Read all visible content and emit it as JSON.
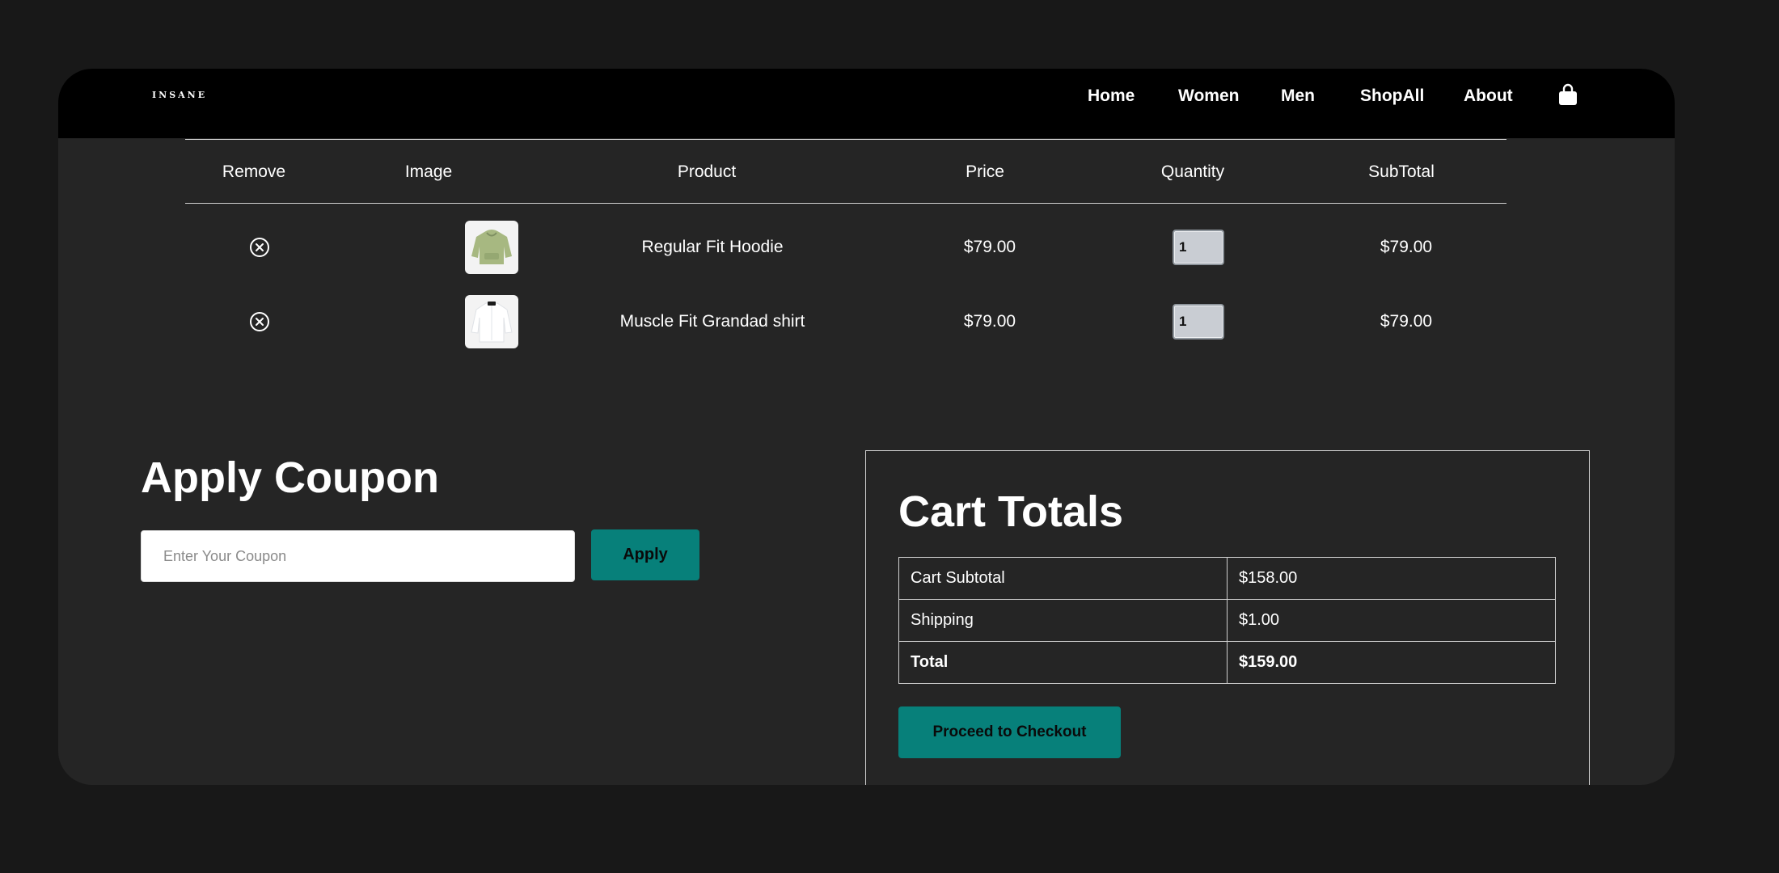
{
  "brand": {
    "logo_text": "INSANE"
  },
  "nav": {
    "items": [
      {
        "label": "Home"
      },
      {
        "label": "Women"
      },
      {
        "label": "Men"
      },
      {
        "label": "ShopAll"
      },
      {
        "label": "About"
      }
    ],
    "cart_icon": "shopping-bag-icon"
  },
  "cart": {
    "headers": [
      "Remove",
      "Image",
      "Product",
      "Price",
      "Quantity",
      "SubTotal"
    ],
    "rows": [
      {
        "product": "Regular Fit Hoodie",
        "price": "$79.00",
        "quantity": "1",
        "subtotal": "$79.00",
        "image_icon": "hoodie-thumbnail"
      },
      {
        "product": "Muscle Fit Grandad shirt",
        "price": "$79.00",
        "quantity": "1",
        "subtotal": "$79.00",
        "image_icon": "shirt-thumbnail"
      }
    ],
    "remove_icon": "remove-circle-x-icon"
  },
  "coupon": {
    "title": "Apply Coupon",
    "placeholder": "Enter Your Coupon",
    "value": "",
    "apply_label": "Apply"
  },
  "totals": {
    "title": "Cart Totals",
    "rows": [
      {
        "label": "Cart Subtotal",
        "value": "$158.00"
      },
      {
        "label": "Shipping",
        "value": "$1.00"
      },
      {
        "label": "Total",
        "value": "$159.00"
      }
    ],
    "checkout_label": "Proceed to Checkout"
  },
  "colors": {
    "page_bg": "#181818",
    "panel_bg": "#252525",
    "navbar_bg": "#000000",
    "accent": "#07807a"
  }
}
